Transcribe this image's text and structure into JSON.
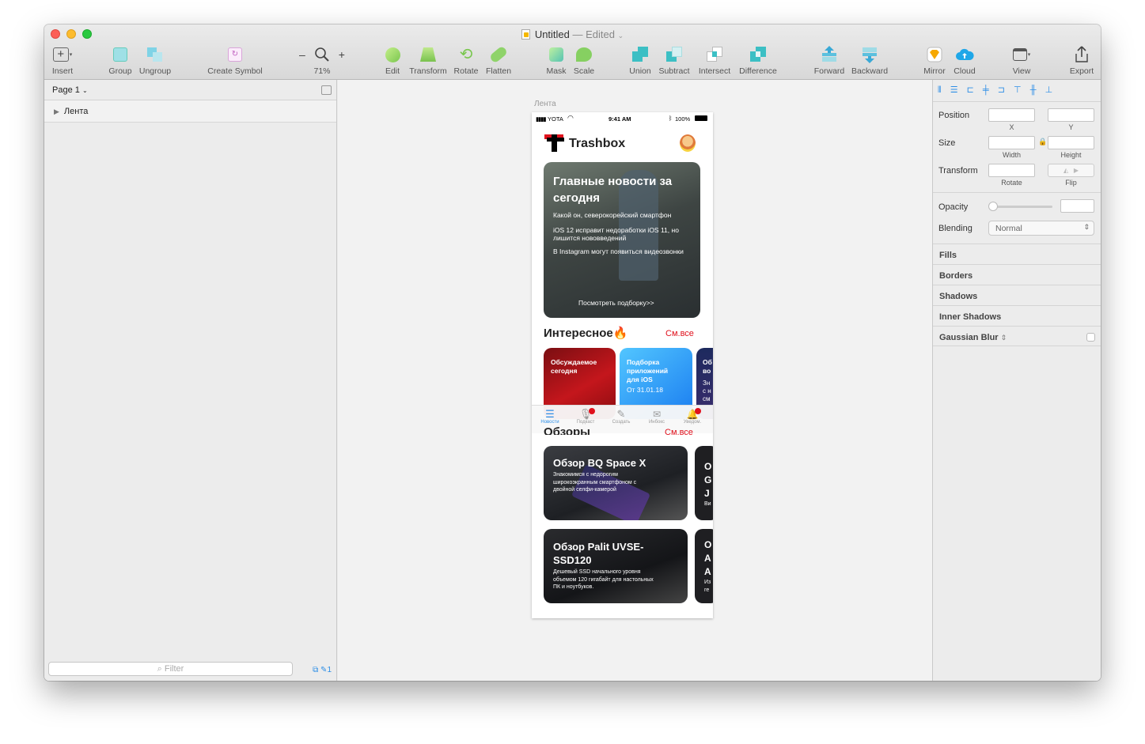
{
  "window": {
    "title": "Untitled",
    "status": "— Edited"
  },
  "toolbar": {
    "insert": "Insert",
    "group": "Group",
    "ungroup": "Ungroup",
    "create_symbol": "Create Symbol",
    "zoom": "71%",
    "zoom_minus": "–",
    "zoom_plus": "+",
    "edit": "Edit",
    "transform": "Transform",
    "rotate": "Rotate",
    "flatten": "Flatten",
    "mask": "Mask",
    "scale": "Scale",
    "union": "Union",
    "subtract": "Subtract",
    "intersect": "Intersect",
    "difference": "Difference",
    "forward": "Forward",
    "backward": "Backward",
    "mirror": "Mirror",
    "cloud": "Cloud",
    "view": "View",
    "export": "Export"
  },
  "sidebar": {
    "page": "Page 1",
    "layers": [
      "Лента"
    ],
    "filter_placeholder": "Filter",
    "count": "1"
  },
  "canvas": {
    "artboard_name": "Лента"
  },
  "phone": {
    "carrier": "YOTA",
    "time": "9:41 AM",
    "battery": "100%",
    "brand": "Trashbox",
    "hero": {
      "title": "Главные новости за сегодня",
      "items": [
        "Какой он, северокорейский смартфон",
        "iOS 12 исправит недоработки iOS 11, но лишится нововведений",
        "В Instagram могут появиться видеозвонки"
      ],
      "more": "Посмотреть подборку>>"
    },
    "section1": {
      "title": "Интересное🔥",
      "see_all": "См.все"
    },
    "tiles": [
      {
        "title": "Обсуждаемое сегодня"
      },
      {
        "title": "Подборка приложений для iOS",
        "sub": "От 31.01.18"
      },
      {
        "title": "Об во",
        "sub": "Зн с н см"
      }
    ],
    "tabbar": [
      "Новости",
      "Подкаст",
      "Создать",
      "Инбокс",
      "Уведом."
    ],
    "section2": {
      "title": "Обзоры",
      "see_all": "См.все"
    },
    "reviews": [
      {
        "title": "Обзор BQ Space X",
        "desc": "Знакомимся с недорогим широкоэкранным смартфоном с двойной селфи-камерой"
      },
      {
        "title": "Обзор Palit UVSE-SSD120",
        "desc": "Дешевый SSD начального уровня объемом 120 гигабайт для настольных ПК и ноутбуков."
      }
    ],
    "peek1": [
      "О",
      "G",
      "J",
      "Ви"
    ],
    "peek2": [
      "О",
      "A",
      "A",
      "Из",
      "ге"
    ]
  },
  "inspector": {
    "position": "Position",
    "x": "X",
    "y": "Y",
    "size": "Size",
    "width": "Width",
    "height": "Height",
    "transform": "Transform",
    "rotate": "Rotate",
    "flip": "Flip",
    "opacity": "Opacity",
    "blending": "Blending",
    "blend_value": "Normal",
    "sections": [
      "Fills",
      "Borders",
      "Shadows",
      "Inner Shadows",
      "Gaussian Blur"
    ]
  },
  "colors": {
    "accent": "#2d8ee6",
    "red": "#e0111d",
    "yellow": "#f2b707"
  }
}
